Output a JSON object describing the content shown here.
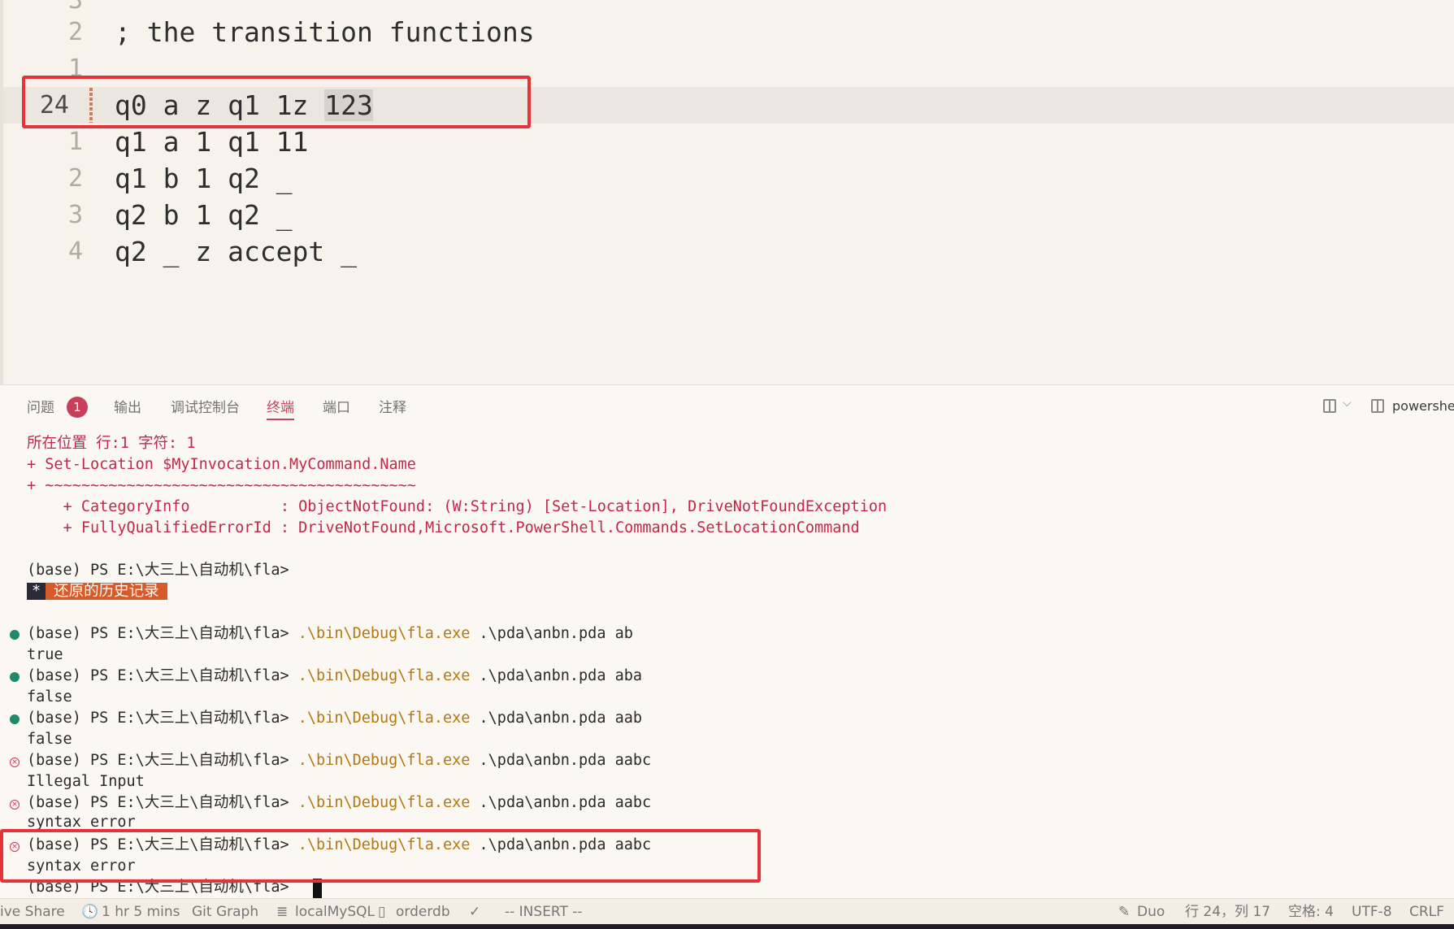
{
  "editor": {
    "top_partial_num": "3",
    "lines": [
      {
        "num": "2",
        "code": "; the transition functions"
      },
      {
        "num": "1",
        "code": ""
      },
      {
        "num": "24",
        "code_prefix": "q0 a z q1 1z ",
        "code_highlight": "123"
      },
      {
        "num": "1",
        "code": "q1 a 1 q1 11"
      },
      {
        "num": "2",
        "code": "q1 b 1 q2 _"
      },
      {
        "num": "3",
        "code": "q2 b 1 q2 _"
      },
      {
        "num": "4",
        "code": "q2 _ z accept _"
      }
    ]
  },
  "panel": {
    "tabs": {
      "problems": "问题",
      "problems_count": "1",
      "output": "输出",
      "debug_console": "调试控制台",
      "terminal": "终端",
      "ports": "端口",
      "comments": "注释"
    },
    "shell_name": "powershell",
    "terminal": {
      "err1": "所在位置 行:1 字符: 1",
      "err2": "+ Set-Location $MyInvocation.MyCommand.Name",
      "err3": "+ ~~~~~~~~~~~~~~~~~~~~~~~~~~~~~~~~~~~~~~~~~",
      "err4": "    + CategoryInfo          : ObjectNotFound: (W:String) [Set-Location], DriveNotFoundException",
      "err5": "    + FullyQualifiedErrorId : DriveNotFound,Microsoft.PowerShell.Commands.SetLocationCommand",
      "prompt": "(base) PS E:\\大三上\\自动机\\fla>",
      "restored_star": "*",
      "restored_text": "还原的历史记录",
      "exe": ".\\bin\\Debug\\fla.exe",
      "runs": [
        {
          "status": "ok",
          "args": " .\\pda\\anbn.pda ab",
          "out": "true"
        },
        {
          "status": "ok",
          "args": " .\\pda\\anbn.pda aba",
          "out": "false"
        },
        {
          "status": "ok",
          "args": " .\\pda\\anbn.pda aab",
          "out": "false"
        },
        {
          "status": "bad",
          "args": " .\\pda\\anbn.pda aabc",
          "out": "Illegal Input"
        },
        {
          "status": "bad",
          "args": " .\\pda\\anbn.pda aabc",
          "out": "syntax error"
        },
        {
          "status": "bad",
          "args": " .\\pda\\anbn.pda aabc",
          "out": "syntax error"
        }
      ]
    }
  },
  "statusbar": {
    "live_share": "ive Share",
    "time": "1 hr 5 mins",
    "git_graph": "Git Graph",
    "mysql": "localMySQL",
    "db": "orderdb",
    "check": "✓",
    "mode": "-- INSERT --",
    "duo": "Duo",
    "position": "行 24，列 17",
    "spaces": "空格: 4",
    "encoding": "UTF-8",
    "eol": "CRLF"
  },
  "colors": {
    "accent": "#c2455f",
    "error_text": "#c4274a",
    "command_path": "#b5780e",
    "highlight_box": "#e8323a",
    "ok_dot": "#1f8a6a"
  }
}
